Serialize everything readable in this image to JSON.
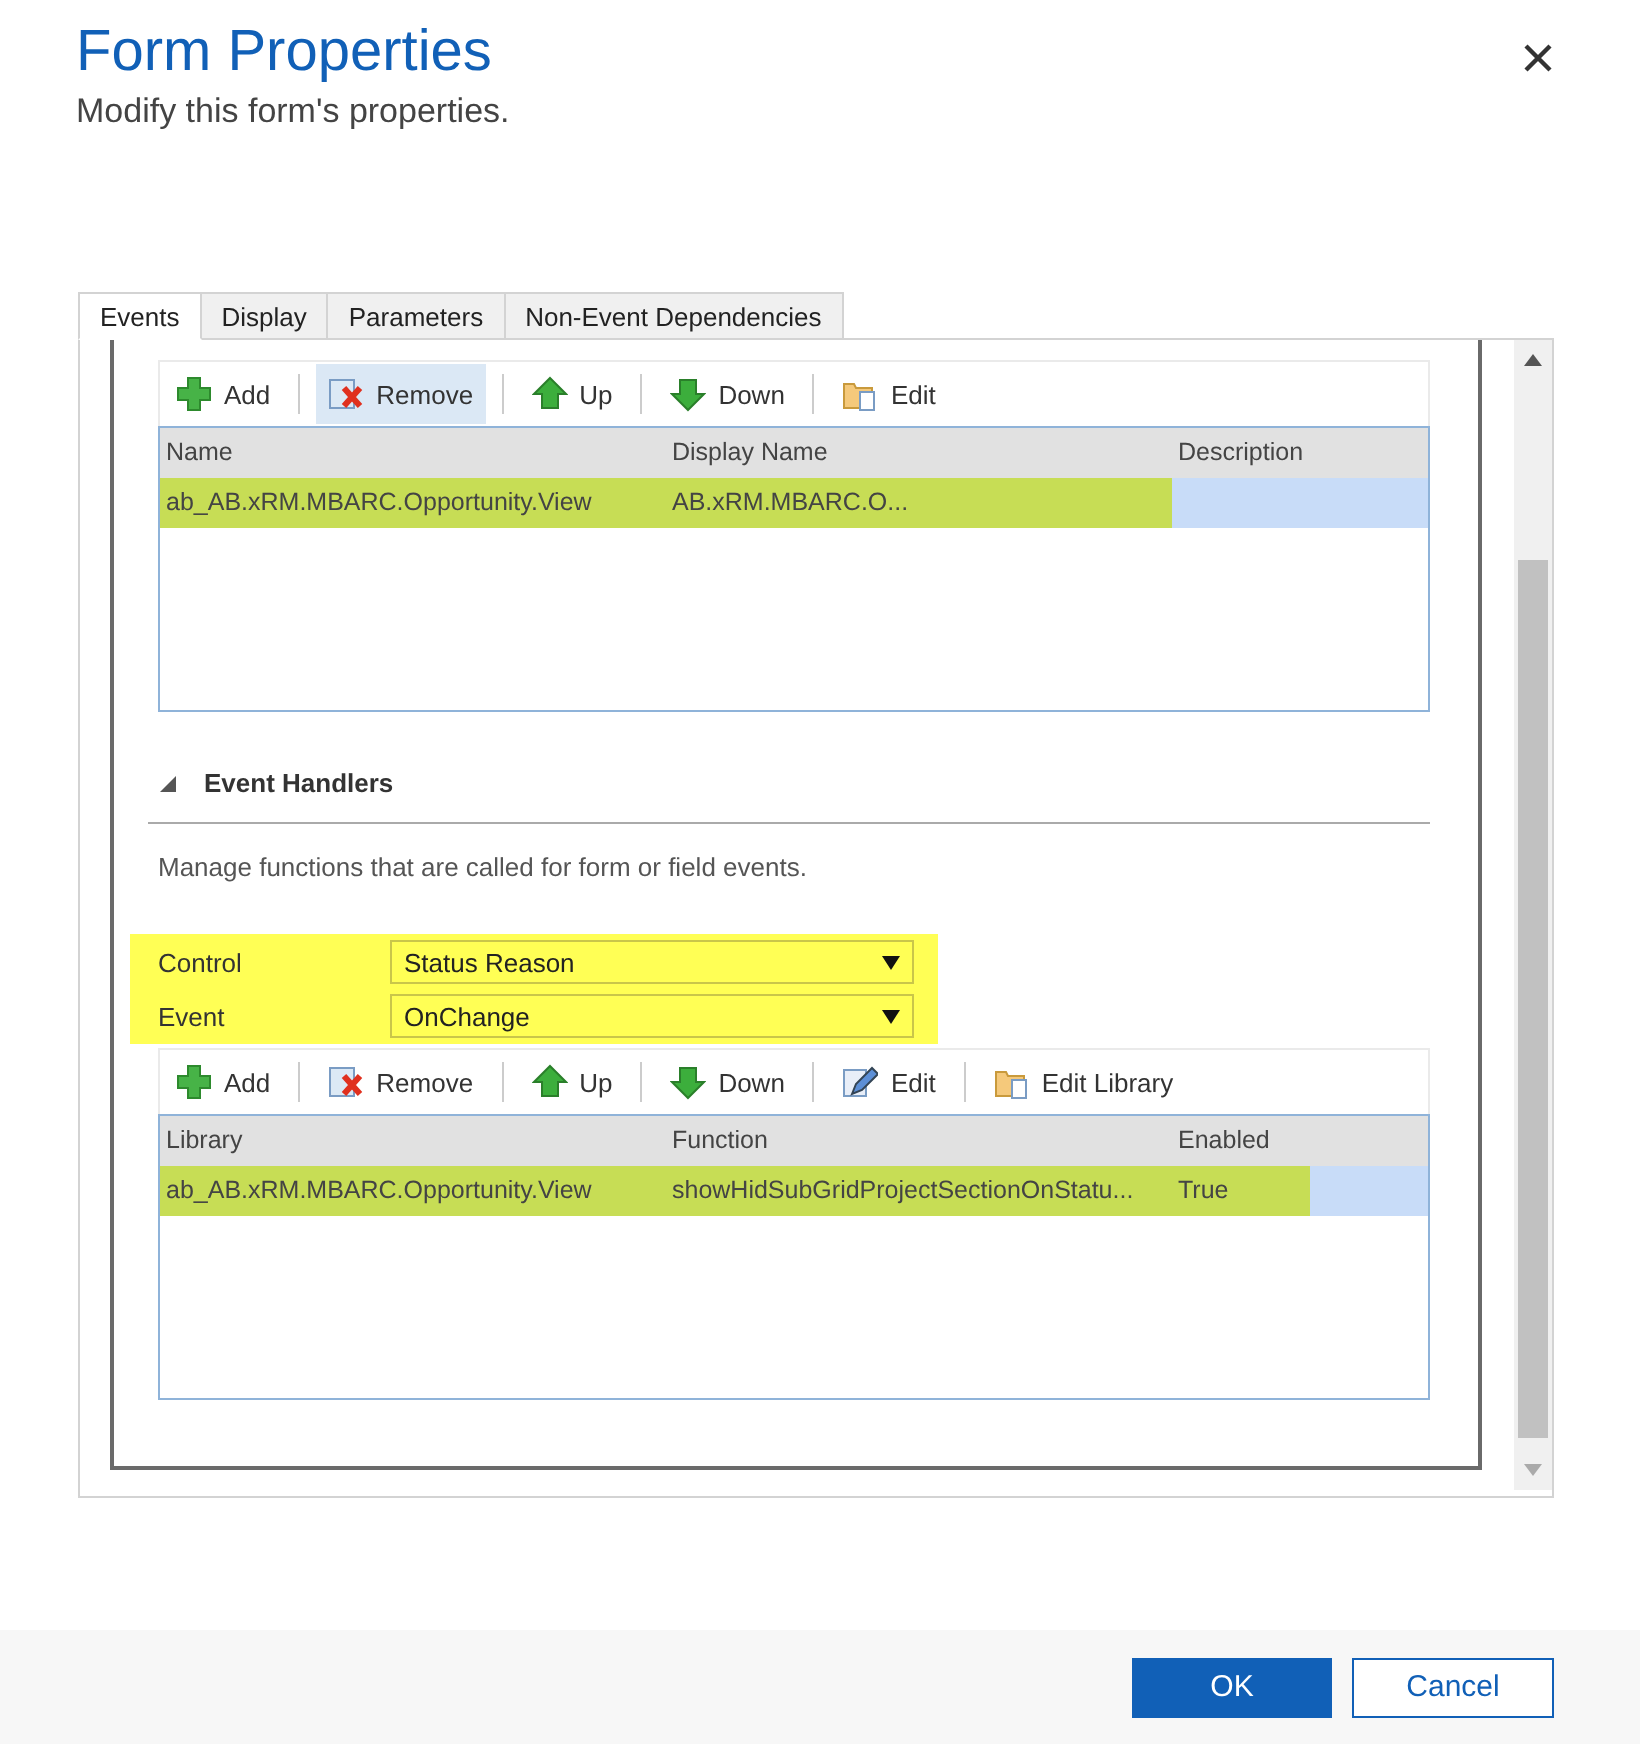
{
  "dialog": {
    "title": "Form Properties",
    "subtitle": "Modify this form's properties."
  },
  "tabs": [
    {
      "label": "Events",
      "selected": true
    },
    {
      "label": "Display",
      "selected": false
    },
    {
      "label": "Parameters",
      "selected": false
    },
    {
      "label": "Non-Event Dependencies",
      "selected": false
    }
  ],
  "libraries": {
    "toolbar": [
      {
        "kind": "add",
        "label": "Add",
        "hovered": false
      },
      {
        "kind": "remove",
        "label": "Remove",
        "hovered": true
      },
      {
        "kind": "up",
        "label": "Up",
        "hovered": false
      },
      {
        "kind": "down",
        "label": "Down",
        "hovered": false
      },
      {
        "kind": "edit-library",
        "label": "Edit",
        "hovered": false
      }
    ],
    "columns": [
      "Name",
      "Display Name",
      "Description"
    ],
    "rows": [
      {
        "cells": [
          "ab_AB.xRM.MBARC.Opportunity.View",
          "AB.xRM.MBARC.O...",
          ""
        ],
        "selected": true,
        "highlighted": true
      }
    ]
  },
  "event_handlers": {
    "title": "Event Handlers",
    "expanded": true,
    "description": "Manage functions that are called for form or field events.",
    "fields": [
      {
        "label": "Control",
        "value": "Status Reason"
      },
      {
        "label": "Event",
        "value": "OnChange"
      }
    ],
    "toolbar": [
      {
        "kind": "add",
        "label": "Add",
        "hovered": false
      },
      {
        "kind": "remove",
        "label": "Remove",
        "hovered": false
      },
      {
        "kind": "up",
        "label": "Up",
        "hovered": false
      },
      {
        "kind": "down",
        "label": "Down",
        "hovered": false
      },
      {
        "kind": "edit",
        "label": "Edit",
        "hovered": false
      },
      {
        "kind": "edit-library",
        "label": "Edit Library",
        "hovered": false
      }
    ],
    "columns": [
      "Library",
      "Function",
      "Enabled"
    ],
    "rows": [
      {
        "cells": [
          "ab_AB.xRM.MBARC.Opportunity.View",
          "showHidSubGridProjectSectionOnStatu...",
          "True"
        ],
        "selected": true,
        "highlighted": true
      }
    ]
  },
  "buttons": [
    {
      "label": "OK",
      "kind": "primary"
    },
    {
      "label": "Cancel",
      "kind": "secondary"
    }
  ]
}
